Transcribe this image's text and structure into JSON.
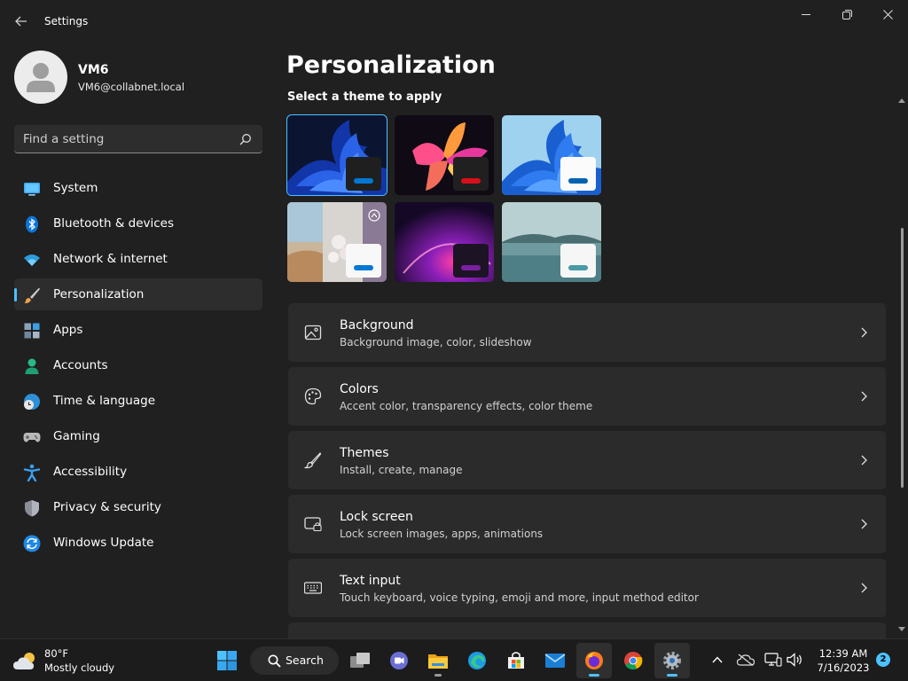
{
  "window": {
    "app_title": "Settings",
    "back_icon": "back-arrow-icon",
    "controls": [
      "minimize-icon",
      "restore-icon",
      "close-icon"
    ]
  },
  "profile": {
    "name": "VM6",
    "email": "VM6@collabnet.local"
  },
  "search": {
    "placeholder": "Find a setting",
    "value": ""
  },
  "nav": {
    "selected": "Personalization",
    "items": [
      {
        "label": "System",
        "icon": "system-display-icon"
      },
      {
        "label": "Bluetooth & devices",
        "icon": "bluetooth-icon"
      },
      {
        "label": "Network & internet",
        "icon": "wifi-icon"
      },
      {
        "label": "Personalization",
        "icon": "paintbrush-icon"
      },
      {
        "label": "Apps",
        "icon": "apps-icon"
      },
      {
        "label": "Accounts",
        "icon": "accounts-icon"
      },
      {
        "label": "Time & language",
        "icon": "clock-globe-icon"
      },
      {
        "label": "Gaming",
        "icon": "gamepad-icon"
      },
      {
        "label": "Accessibility",
        "icon": "accessibility-icon"
      },
      {
        "label": "Privacy & security",
        "icon": "shield-icon"
      },
      {
        "label": "Windows Update",
        "icon": "update-icon"
      }
    ]
  },
  "page": {
    "title": "Personalization",
    "theme_heading": "Select a theme to apply"
  },
  "themes": [
    {
      "name": "bloom-dark",
      "accent": "#0078d4",
      "selected": true
    },
    {
      "name": "glow-flower",
      "accent": "#d80f1a",
      "selected": false
    },
    {
      "name": "bloom-light",
      "accent": "#0063b1",
      "selected": false
    },
    {
      "name": "captured-motion",
      "accent": "#0078d4",
      "selected": false
    },
    {
      "name": "sunrise-purple",
      "accent": "#7b1fa2",
      "selected": false
    },
    {
      "name": "flow-lake",
      "accent": "#4a9aa6",
      "selected": false
    }
  ],
  "cards": [
    {
      "title": "Background",
      "subtitle": "Background image, color, slideshow",
      "icon": "image-icon"
    },
    {
      "title": "Colors",
      "subtitle": "Accent color, transparency effects, color theme",
      "icon": "palette-icon"
    },
    {
      "title": "Themes",
      "subtitle": "Install, create, manage",
      "icon": "brush-icon"
    },
    {
      "title": "Lock screen",
      "subtitle": "Lock screen images, apps, animations",
      "icon": "lock-screen-icon"
    },
    {
      "title": "Text input",
      "subtitle": "Touch keyboard, voice typing, emoji and more, input method editor",
      "icon": "keyboard-icon"
    }
  ],
  "taskbar": {
    "weather": {
      "temp": "80°F",
      "desc": "Mostly cloudy",
      "icon": "partly-cloudy-icon"
    },
    "search_label": "Search",
    "apps": [
      "start-icon",
      "task-view-icon",
      "teams-chat-icon",
      "file-explorer-icon",
      "edge-icon",
      "store-icon",
      "mail-icon",
      "firefox-icon",
      "chrome-icon",
      "settings-gear-icon"
    ],
    "tray": [
      "chevron-up-icon",
      "onedrive-icon",
      "network-icon",
      "volume-icon"
    ],
    "time": "12:39 AM",
    "date": "7/16/2023",
    "notifications": "2"
  },
  "colors": {
    "accent": "#4cc2ff",
    "background": "#202020",
    "card": "#2b2b2b"
  }
}
